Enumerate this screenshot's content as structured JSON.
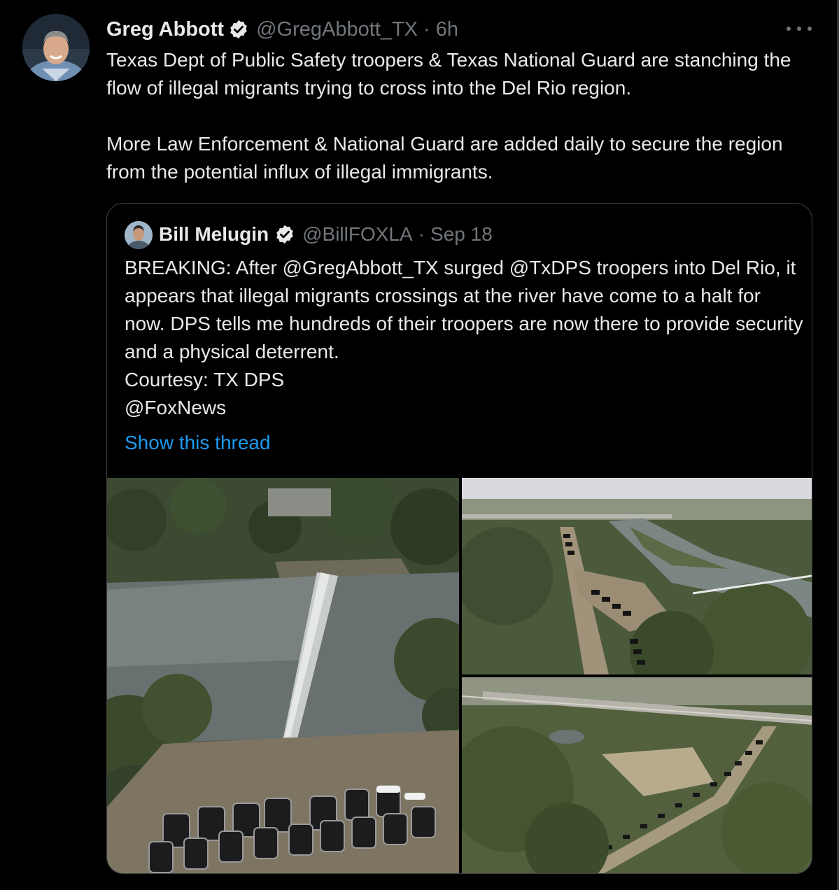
{
  "tweet": {
    "author_name": "Greg Abbott",
    "author_handle": "@GregAbbott_TX",
    "separator": "·",
    "timestamp": "6h",
    "text_paragraphs": [
      "Texas Dept of Public Safety troopers & Texas National Guard are stanching the flow of illegal migrants trying to cross into the Del Rio region.",
      "More Law Enforcement & National Guard are added daily to secure the region from the potential influx of illegal immigrants."
    ]
  },
  "quoted_tweet": {
    "author_name": "Bill Melugin",
    "author_handle": "@BillFOXLA",
    "separator": "·",
    "timestamp": "Sep 18",
    "text_lines": [
      "BREAKING: After @GregAbbott_TX surged @TxDPS troopers into Del Rio, it appears that illegal migrants crossings at the river have come to a halt for now. DPS tells me hundreds of their troopers are now there to provide security and a physical deterrent.",
      "Courtesy: TX DPS",
      "@FoxNews"
    ],
    "show_thread_label": "Show this thread"
  },
  "icons": {
    "verified": "verified-badge-icon",
    "more": "more-options-icon"
  },
  "colors": {
    "background": "#000000",
    "text_primary": "#e7e9ea",
    "text_secondary": "#71767b",
    "link": "#1d9bf0",
    "card_border": "#3e4144"
  }
}
